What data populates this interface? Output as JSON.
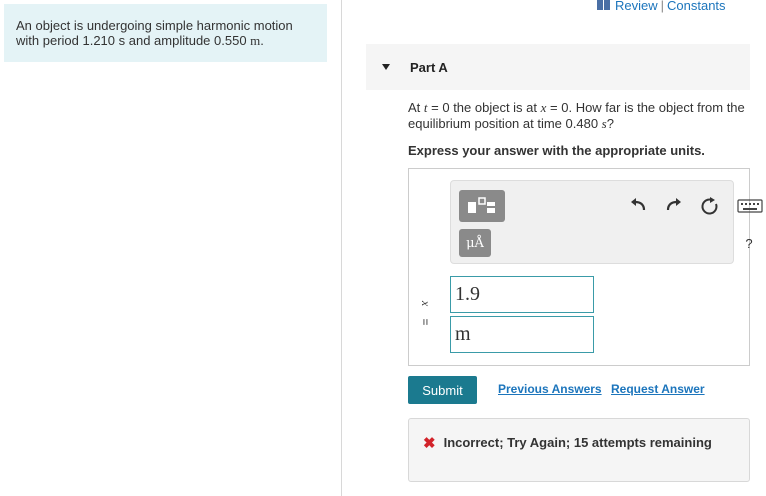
{
  "problem": {
    "text_prefix": "An object is undergoing simple harmonic motion with period 1.210 s and amplitude 0.550 ",
    "unit": "m",
    "text_suffix": "."
  },
  "header_links": {
    "review": "Review",
    "separator": "|",
    "constants": "Constants"
  },
  "part": {
    "title": "Part A"
  },
  "question": {
    "t1": "At ",
    "var_t": "t",
    "t2": " = 0 the object is at ",
    "var_x": "x",
    "t3": " = 0. How far is the object from the equilibrium position at time 0.480 ",
    "var_s": "s",
    "t4": "?"
  },
  "instruction": "Express your answer with the appropriate units.",
  "toolbar": {
    "units_label": "μÅ",
    "help_label": "?"
  },
  "answer": {
    "var": "x",
    "equals": "=",
    "value": "1.9",
    "unit": "m"
  },
  "actions": {
    "submit": "Submit",
    "previous_answers": "Previous Answers",
    "request_answer": "Request Answer"
  },
  "feedback": {
    "icon": "x-icon",
    "message": "Incorrect; Try Again; 15 attempts remaining",
    "color": "#d2232a"
  },
  "colors": {
    "accent": "#1b7a8f",
    "link": "#1c75bc",
    "problem_bg": "#e4f3f6"
  }
}
